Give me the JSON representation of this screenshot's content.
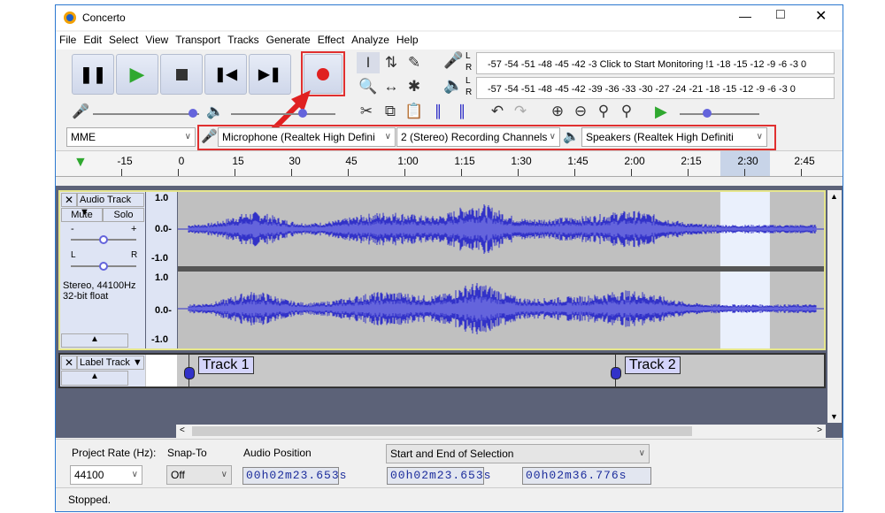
{
  "window": {
    "title": "Concerto"
  },
  "menu": [
    "File",
    "Edit",
    "Select",
    "View",
    "Transport",
    "Tracks",
    "Generate",
    "Effect",
    "Analyze",
    "Help"
  ],
  "meters": {
    "record_hint": "Click to Start Monitoring",
    "record_left": "-57 -54 -51 -48 -45 -42 -3",
    "record_right": "!1 -18 -15 -12 -9 -6 -3 0",
    "playback_scale": "-57 -54 -51 -48 -45 -42 -39 -36 -33 -30 -27 -24 -21 -18 -15 -12 -9 -6 -3 0",
    "L": "L",
    "R": "R"
  },
  "devices": {
    "host": "MME",
    "mic": "Microphone (Realtek High Defini",
    "channels": "2 (Stereo) Recording Channels",
    "speaker": "Speakers (Realtek High Definiti"
  },
  "ruler": {
    "labels": [
      "-15",
      "0",
      "15",
      "30",
      "45",
      "1:00",
      "1:15",
      "1:30",
      "1:45",
      "2:00",
      "2:15",
      "2:30",
      "2:45"
    ],
    "seconds_per_label": 15,
    "selection_start_s": 143.653,
    "selection_end_s": 156.776
  },
  "audio_track": {
    "name": "Audio Track",
    "mute": "Mute",
    "solo": "Solo",
    "gain_minus": "-",
    "gain_plus": "+",
    "pan_l": "L",
    "pan_r": "R",
    "info1": "Stereo, 44100Hz",
    "info2": "32-bit float",
    "scale": [
      "1.0",
      "0.0-",
      "-1.0"
    ],
    "gain_level": 0.5,
    "pan_level": 0.5
  },
  "label_track": {
    "name": "Label Track",
    "labels": [
      {
        "text": "Track 1",
        "time_s": 3
      },
      {
        "text": "Track 2",
        "time_s": 116
      }
    ]
  },
  "selection_bar": {
    "project_rate_label": "Project Rate (Hz):",
    "project_rate": "44100",
    "snap_label": "Snap-To",
    "snap": "Off",
    "audio_pos_label": "Audio Position",
    "audio_pos": "00h02m23.653s",
    "selection_label": "Start and End of Selection",
    "sel_start": "00h02m23.653s",
    "sel_end": "00h02m36.776s"
  },
  "status": "Stopped.",
  "colors": {
    "wave": "#3232c8",
    "wave_rms": "#6464dc",
    "selection": "#eaf0fc",
    "track_bg": "#5c6278",
    "record": "#e02020",
    "highlight": "#e03030"
  }
}
